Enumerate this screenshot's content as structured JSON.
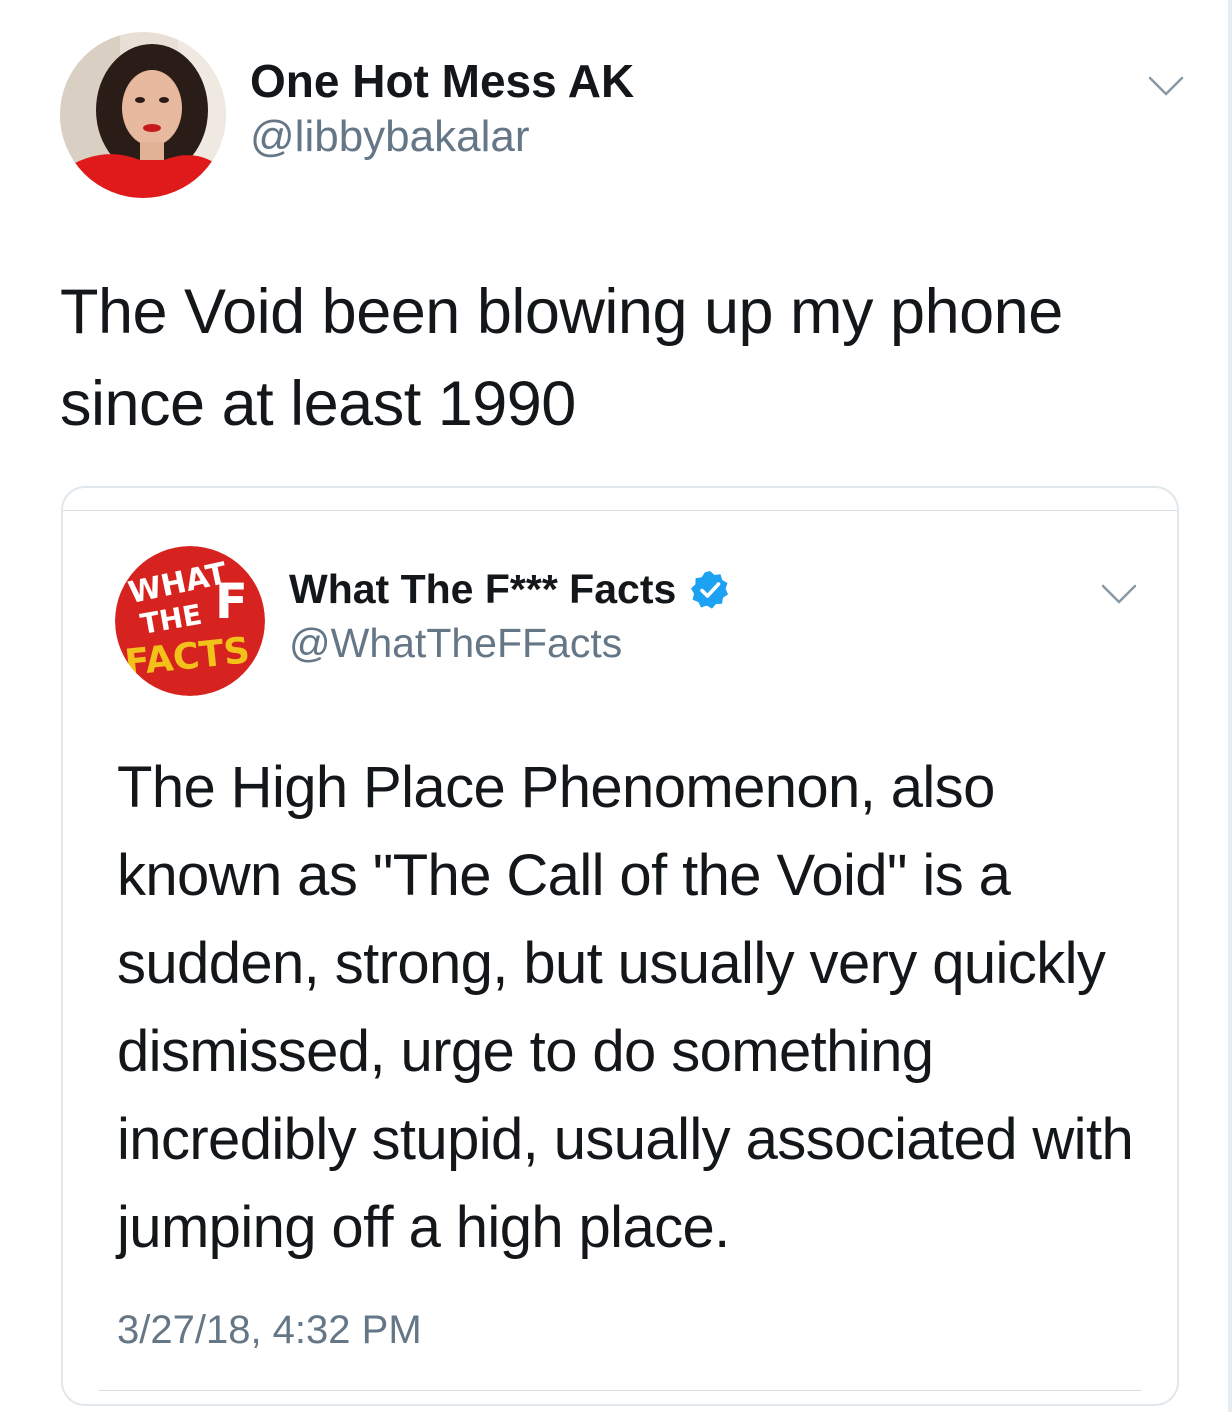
{
  "tweet": {
    "author": {
      "display_name": "One Hot Mess AK",
      "handle": "@libbybakalar",
      "avatar": "profile-photo-avatar"
    },
    "text": "The Void been blowing up my phone since at least 1990",
    "menu_icon": "chevron-down-icon"
  },
  "quoted_tweet": {
    "author": {
      "display_name": "What The F*** Facts",
      "handle": "@WhatTheFFacts",
      "avatar": "what-the-facts-logo",
      "logo_text": "WHAT THE F FACTS",
      "verified": true
    },
    "text": "The High Place Phenomenon, also known as \"The Call of the Void\" is a sudden, strong, but usually very quickly dismissed, urge to do something incredibly stupid, usually associated with jumping off a high place.",
    "timestamp": "3/27/18, 4:32 PM",
    "menu_icon": "chevron-down-icon"
  },
  "colors": {
    "text_primary": "#14171a",
    "text_secondary": "#657786",
    "verified_blue": "#1da1f2",
    "border": "#e1e8ed",
    "logo_red": "#d7231f"
  }
}
